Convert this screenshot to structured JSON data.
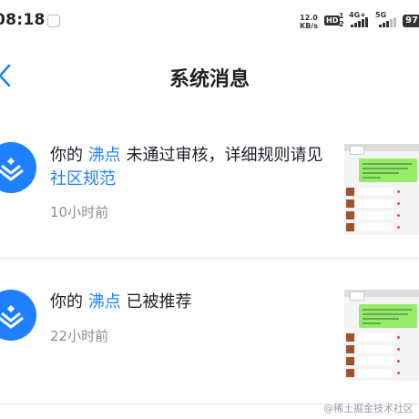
{
  "status_bar": {
    "time": "08:18",
    "net_speed_value": "12.0",
    "net_speed_unit": "KB/s",
    "hd_label": "HD",
    "hd_sub_1": "1",
    "hd_sub_2": "2",
    "sim1_label": "4G+",
    "sim2_label": "5G",
    "battery": "97"
  },
  "header": {
    "title": "系统消息"
  },
  "messages": [
    {
      "prefix": "你的",
      "link1": "沸点",
      "middle": "未通过审核，详细规则请见",
      "link2": "社区规范",
      "time": "10小时前"
    },
    {
      "prefix": "你的",
      "link1": "沸点",
      "middle": "已被推荐",
      "link2": "",
      "time": "22小时前"
    }
  ],
  "watermark": "@稀土掘金技术社区",
  "colors": {
    "accent": "#1e80ff",
    "text": "#1d2129",
    "muted": "#86909c",
    "divider": "#e5e6eb"
  }
}
